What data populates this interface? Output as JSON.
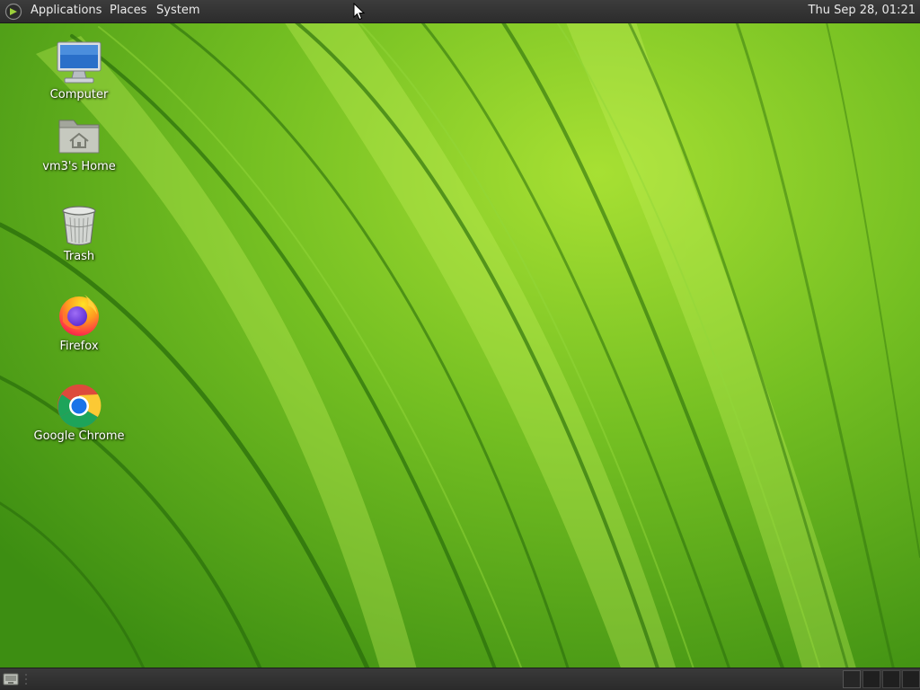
{
  "top_panel": {
    "logo_icon": "distro-logo-icon",
    "menus": {
      "applications": "Applications",
      "places": "Places",
      "system": "System"
    },
    "clock": "Thu Sep 28, 01:21"
  },
  "desktop": {
    "wallpaper": "green leaf",
    "accent_colors": [
      "#2f7d0f",
      "#5aa31c",
      "#8fd22c",
      "#b7ea3f"
    ],
    "icons": {
      "computer": {
        "label": "Computer",
        "icon": "computer-monitor-icon"
      },
      "home": {
        "label": "vm3's Home",
        "icon": "home-folder-icon"
      },
      "trash": {
        "label": "Trash",
        "icon": "trash-icon"
      },
      "firefox": {
        "label": "Firefox",
        "icon": "firefox-icon"
      },
      "chrome": {
        "label": "Google Chrome",
        "icon": "chrome-icon"
      }
    }
  },
  "bottom_panel": {
    "show_desktop_icon": "show-desktop-icon",
    "workspaces": 4
  }
}
